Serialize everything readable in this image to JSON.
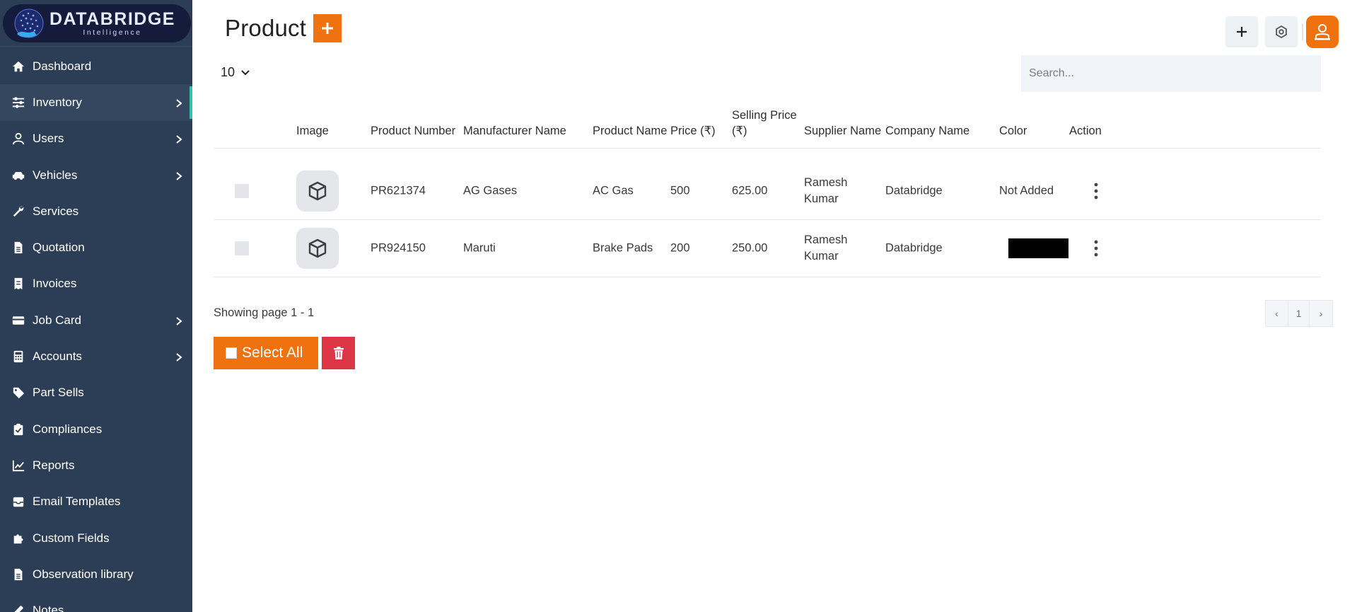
{
  "brand": {
    "title": "DATABRIDGE",
    "subtitle": "Intelligence"
  },
  "sidebar": {
    "items": [
      {
        "label": "Dashboard",
        "icon": "home-icon",
        "chevron": false,
        "active": false
      },
      {
        "label": "Inventory",
        "icon": "sliders-icon",
        "chevron": true,
        "active": true
      },
      {
        "label": "Users",
        "icon": "user-icon",
        "chevron": true,
        "active": false
      },
      {
        "label": "Vehicles",
        "icon": "car-icon",
        "chevron": true,
        "active": false
      },
      {
        "label": "Services",
        "icon": "wrench-icon",
        "chevron": false,
        "active": false
      },
      {
        "label": "Quotation",
        "icon": "file-icon",
        "chevron": false,
        "active": false
      },
      {
        "label": "Invoices",
        "icon": "receipt-icon",
        "chevron": false,
        "active": false
      },
      {
        "label": "Job Card",
        "icon": "card-icon",
        "chevron": true,
        "active": false
      },
      {
        "label": "Accounts",
        "icon": "calculator-icon",
        "chevron": true,
        "active": false
      },
      {
        "label": "Part Sells",
        "icon": "tag-icon",
        "chevron": false,
        "active": false
      },
      {
        "label": "Compliances",
        "icon": "clipboard-icon",
        "chevron": false,
        "active": false
      },
      {
        "label": "Reports",
        "icon": "chart-line-icon",
        "chevron": false,
        "active": false
      },
      {
        "label": "Email Templates",
        "icon": "inbox-icon",
        "chevron": false,
        "active": false
      },
      {
        "label": "Custom Fields",
        "icon": "puzzle-icon",
        "chevron": false,
        "active": false
      },
      {
        "label": "Observation library",
        "icon": "file-icon",
        "chevron": false,
        "active": false
      },
      {
        "label": "Notes",
        "icon": "pen-icon",
        "chevron": false,
        "active": false
      }
    ]
  },
  "header": {
    "title": "Product"
  },
  "controls": {
    "per_page": "10",
    "search_placeholder": "Search..."
  },
  "table": {
    "columns": {
      "image": "Image",
      "product_number": "Product Number",
      "manufacturer": "Manufacturer Name",
      "product_name": "Product Name",
      "price": "Price (₹)",
      "selling_price_1": "Selling Price",
      "selling_price_2": "(₹)",
      "supplier": "Supplier Name",
      "company": "Company Name",
      "color": "Color",
      "action": "Action"
    },
    "rows": [
      {
        "product_number": "PR621374",
        "manufacturer": "AG Gases",
        "product_name": "AC Gas",
        "price": "500",
        "selling_price": "625.00",
        "supplier_1": "Ramesh",
        "supplier_2": "Kumar",
        "company": "Databridge",
        "color_text": "Not Added"
      },
      {
        "product_number": "PR924150",
        "manufacturer": "Maruti",
        "product_name": "Brake Pads",
        "price": "200",
        "selling_price": "250.00",
        "supplier_1": "Ramesh",
        "supplier_2": "Kumar",
        "company": "Databridge",
        "color_swatch": "#000000"
      }
    ]
  },
  "footer": {
    "showing": "Showing page 1 - 1",
    "pager": {
      "prev": "‹",
      "page": "1",
      "next": "›"
    },
    "select_all": "Select All"
  },
  "colors": {
    "accent": "#f0720f",
    "sidebar": "#2c3e55",
    "danger": "#dc3545",
    "active_marker": "#29c7a7"
  }
}
